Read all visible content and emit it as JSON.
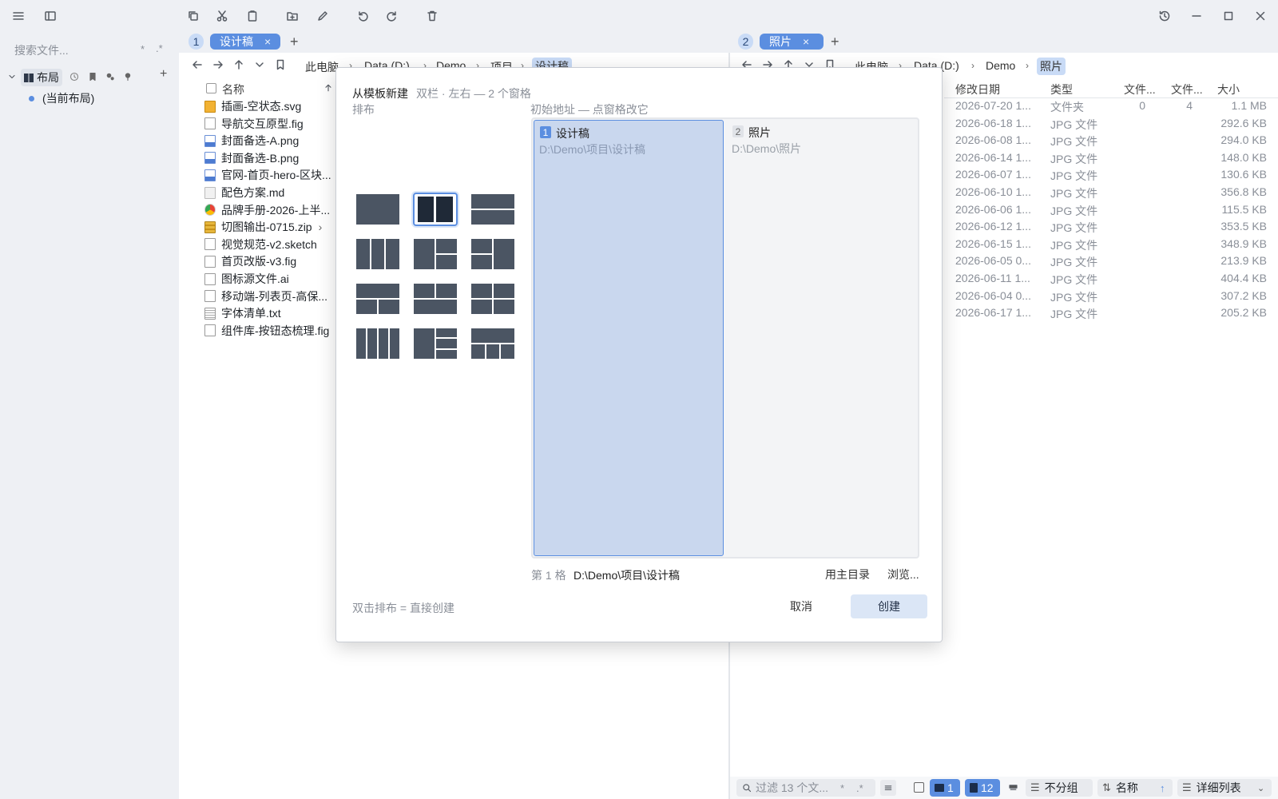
{
  "sidebar": {
    "search_placeholder": "搜索文件...",
    "wildcard": "*",
    "regex": ".*",
    "section_label": "布局",
    "current_layout": "(当前布局)",
    "add": "+"
  },
  "left_pane": {
    "number": "1",
    "tab_label": "设计稿",
    "tab_close": "×",
    "add_tab": "+",
    "breadcrumbs": [
      "此电脑",
      "Data (D:)",
      "Demo",
      "项目",
      "设计稿"
    ],
    "column_name": "名称",
    "files": [
      {
        "name": "插画-空状态.svg",
        "icon": "svg-file-icon"
      },
      {
        "name": "导航交互原型.fig",
        "icon": "file-icon"
      },
      {
        "name": "封面备选-A.png",
        "icon": "image-file-icon"
      },
      {
        "name": "封面备选-B.png",
        "icon": "image-file-icon"
      },
      {
        "name": "官网-首页-hero-区块...",
        "icon": "image-file-icon"
      },
      {
        "name": "配色方案.md",
        "icon": "markdown-file-icon"
      },
      {
        "name": "品牌手册-2026-上半...",
        "icon": "chrome-file-icon"
      },
      {
        "name": "切图输出-0715.zip",
        "icon": "zip-file-icon"
      },
      {
        "name": "视觉规范-v2.sketch",
        "icon": "file-icon"
      },
      {
        "name": "首页改版-v3.fig",
        "icon": "file-icon"
      },
      {
        "name": "图标源文件.ai",
        "icon": "file-icon"
      },
      {
        "name": "移动端-列表页-高保...",
        "icon": "file-icon"
      },
      {
        "name": "字体清单.txt",
        "icon": "text-file-icon"
      },
      {
        "name": "组件库-按钮态梳理.fig",
        "icon": "file-icon"
      }
    ]
  },
  "right_pane": {
    "number": "2",
    "tab_label": "照片",
    "tab_close": "×",
    "add_tab": "+",
    "breadcrumbs": [
      "此电脑",
      "Data (D:)",
      "Demo",
      "照片"
    ],
    "columns": {
      "date": "修改日期",
      "type": "类型",
      "files": "文件...",
      "folders": "文件...",
      "size": "大小"
    },
    "rows": [
      {
        "date": "2026-07-20 1...",
        "type": "文件夹",
        "files": "0",
        "folders": "4",
        "size": "1.1 MB"
      },
      {
        "date": "2026-06-18 1...",
        "type": "JPG 文件",
        "files": "",
        "folders": "",
        "size": "292.6 KB"
      },
      {
        "date": "2026-06-08 1...",
        "type": "JPG 文件",
        "files": "",
        "folders": "",
        "size": "294.0 KB"
      },
      {
        "date": "2026-06-14 1...",
        "type": "JPG 文件",
        "files": "",
        "folders": "",
        "size": "148.0 KB"
      },
      {
        "date": "2026-06-07 1...",
        "type": "JPG 文件",
        "files": "",
        "folders": "",
        "size": "130.6 KB"
      },
      {
        "date": "2026-06-10 1...",
        "type": "JPG 文件",
        "files": "",
        "folders": "",
        "size": "356.8 KB"
      },
      {
        "date": "2026-06-06 1...",
        "type": "JPG 文件",
        "files": "",
        "folders": "",
        "size": "115.5 KB"
      },
      {
        "date": "2026-06-12 1...",
        "type": "JPG 文件",
        "files": "",
        "folders": "",
        "size": "353.5 KB"
      },
      {
        "date": "2026-06-15 1...",
        "type": "JPG 文件",
        "files": "",
        "folders": "",
        "size": "348.9 KB"
      },
      {
        "date": "2026-06-05 0...",
        "type": "JPG 文件",
        "files": "",
        "folders": "",
        "size": "213.9 KB"
      },
      {
        "date": "2026-06-11 1...",
        "type": "JPG 文件",
        "files": "",
        "folders": "",
        "size": "404.4 KB"
      },
      {
        "date": "2026-06-04 0...",
        "type": "JPG 文件",
        "files": "",
        "folders": "",
        "size": "307.2 KB"
      },
      {
        "date": "2026-06-17 1...",
        "type": "JPG 文件",
        "files": "",
        "folders": "",
        "size": "205.2 KB"
      }
    ]
  },
  "dialog": {
    "title": "从模板新建",
    "subtitle": "双栏 · 左右 — 2 个窗格",
    "arrange_label": "排布",
    "initial_label": "初始地址 — 点窗格改它",
    "cells": [
      {
        "number": "1",
        "name": "设计稿",
        "path": "D:\\Demo\\项目\\设计稿"
      },
      {
        "number": "2",
        "name": "照片",
        "path": "D:\\Demo\\照片"
      }
    ],
    "cell_info_label": "第 1 格",
    "cell_info_path": "D:\\Demo\\项目\\设计稿",
    "use_home": "用主目录",
    "browse": "浏览...",
    "hint": "双击排布 = 直接创建",
    "cancel": "取消",
    "create": "创建",
    "selected_template": 1
  },
  "statusbar": {
    "filter_placeholder": "过滤 13 个文...",
    "wildcard": "*",
    "regex": ".*",
    "folder_count": "1",
    "file_count": "12",
    "group": "不分组",
    "sort": "名称",
    "view": "详细列表"
  },
  "colors": {
    "accent": "#5b8ee0",
    "accent_light": "#c9dbf6",
    "template_fill": "#4b5563",
    "template_selected": "#1f2937",
    "selection": "#c9d7ee"
  }
}
